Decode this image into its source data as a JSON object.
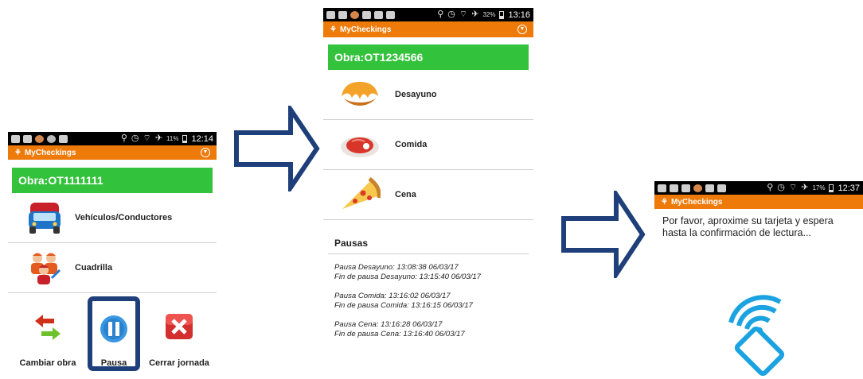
{
  "screen1": {
    "status": {
      "battery": "11%",
      "time": "12:14"
    },
    "app_title": "MyCheckings",
    "obra": "Obra:OT1111111",
    "rows": [
      {
        "icon": "truck-icon",
        "label": "Vehículos/Conductores"
      },
      {
        "icon": "workers-icon",
        "label": "Cuadrilla"
      }
    ],
    "actions": [
      {
        "icon": "swap-arrows-icon",
        "label": "Cambiar obra"
      },
      {
        "icon": "pause-icon",
        "label": "Pausa"
      },
      {
        "icon": "close-icon",
        "label": "Cerrar jornada"
      }
    ]
  },
  "screen2": {
    "status": {
      "battery": "32%",
      "time": "13:16"
    },
    "app_title": "MyCheckings",
    "obra": "Obra:OT1234566",
    "rows": [
      {
        "icon": "croissant-icon",
        "label": "Desayuno"
      },
      {
        "icon": "steak-icon",
        "label": "Comida"
      },
      {
        "icon": "pizza-icon",
        "label": "Cena"
      }
    ],
    "pausas_title": "Pausas",
    "log": [
      "Pausa Desayuno: 13:08:38 06/03/17",
      "Fin de pausa Desayuno: 13:15:40 06/03/17",
      "Pausa Comida: 13:16:02 06/03/17",
      "Fin de pausa Comida: 13:16:15 06/03/17",
      "Pausa Cena: 13:16:28 06/03/17",
      "Fin de pausa Cena: 13:16:40 06/03/17"
    ]
  },
  "screen3": {
    "status": {
      "battery": "17%",
      "time": "12:37"
    },
    "app_title": "MyCheckings",
    "message": "Por favor, aproxime su tarjeta y espera hasta la confirmación de lectura..."
  },
  "colors": {
    "appbar": "#ee7a0a",
    "obra": "#33c23b",
    "arrow_stroke": "#1f3f7a",
    "highlight": "#1f3f7a",
    "nfc": "#1aa3e0"
  }
}
